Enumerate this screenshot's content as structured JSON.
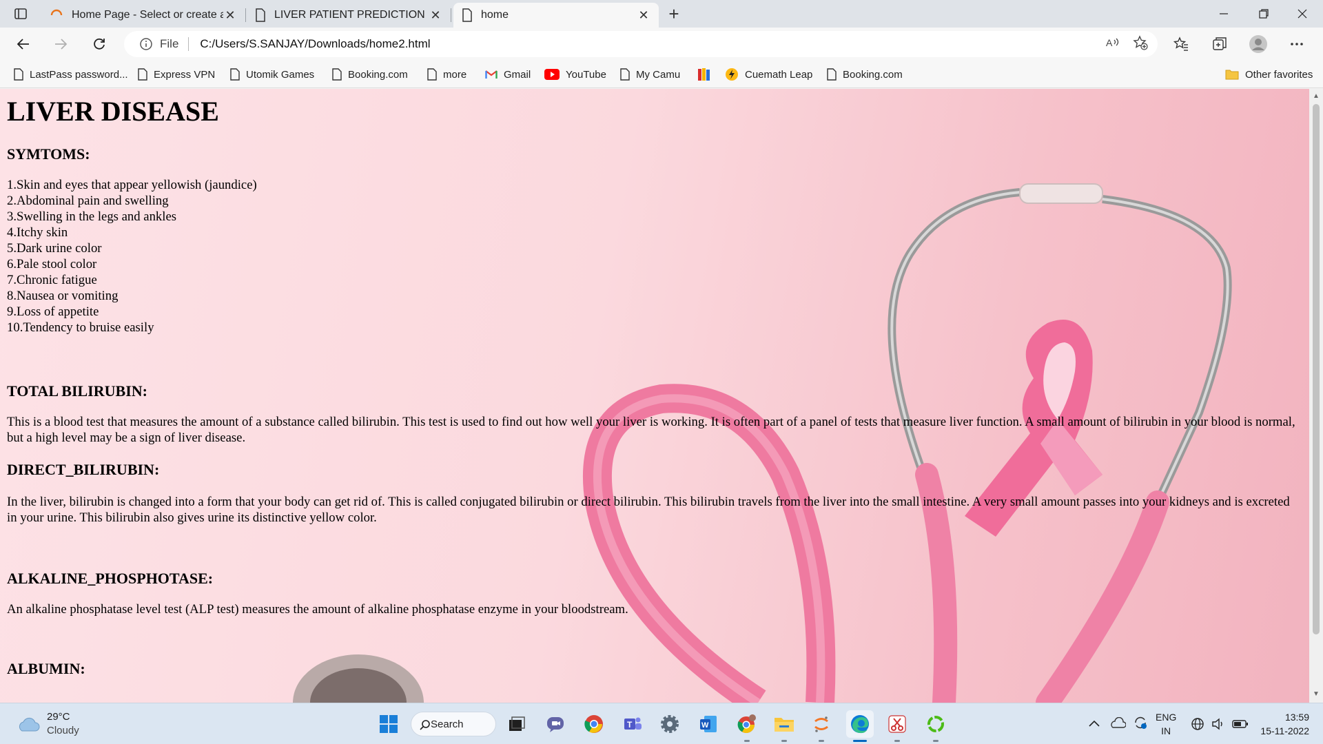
{
  "browser": {
    "tabs": [
      {
        "title": "Home Page - Select or create a n",
        "icon": "loading-spinner-icon",
        "active": false
      },
      {
        "title": "LIVER PATIENT PREDICTION",
        "icon": "page-icon",
        "active": false
      },
      {
        "title": "home",
        "icon": "page-icon",
        "active": true
      }
    ],
    "address": {
      "scheme_label": "File",
      "url": "C:/Users/S.SANJAY/Downloads/home2.html"
    },
    "favorites": [
      {
        "label": "LastPass password...",
        "icon": "page-icon"
      },
      {
        "label": "Express VPN",
        "icon": "page-icon"
      },
      {
        "label": "Utomik Games",
        "icon": "page-icon"
      },
      {
        "label": "Booking.com",
        "icon": "page-icon"
      },
      {
        "label": "more",
        "icon": "page-icon"
      },
      {
        "label": "Gmail",
        "icon": "gmail-icon"
      },
      {
        "label": "YouTube",
        "icon": "youtube-icon"
      },
      {
        "label": "My Camu",
        "icon": "page-icon"
      },
      {
        "label": "",
        "icon": "books-icon"
      },
      {
        "label": "Cuemath Leap",
        "icon": "cuemath-icon"
      },
      {
        "label": "Booking.com",
        "icon": "page-icon"
      }
    ],
    "other_favorites": "Other favorites"
  },
  "page": {
    "title": "LIVER DISEASE",
    "symptoms_heading": "SYMTOMS:",
    "symptoms": [
      "1.Skin and eyes that appear yellowish (jaundice)",
      "2.Abdominal pain and swelling",
      "3.Swelling in the legs and ankles",
      "4.Itchy skin",
      "5.Dark urine color",
      "6.Pale stool color",
      "7.Chronic fatigue",
      "8.Nausea or vomiting",
      "9.Loss of appetite",
      "10.Tendency to bruise easily"
    ],
    "total_bilirubin_heading": "TOTAL BILIRUBIN:",
    "total_bilirubin_text": "This is a blood test that measures the amount of a substance called bilirubin. This test is used to find out how well your liver is working. It is often part of a panel of tests that measure liver function. A small amount of bilirubin in your blood is normal, but a high level may be a sign of liver disease.",
    "direct_bilirubin_heading": "DIRECT_BILIRUBIN:",
    "direct_bilirubin_text": "In the liver, bilirubin is changed into a form that your body can get rid of. This is called conjugated bilirubin or direct bilirubin. This bilirubin travels from the liver into the small intestine. A very small amount passes into your kidneys and is excreted in your urine. This bilirubin also gives urine its distinctive yellow color.",
    "alkaline_heading": "ALKALINE_PHOSPHOTASE:",
    "alkaline_text": "An alkaline phosphatase level test (ALP test) measures the amount of alkaline phosphatase enzyme in your bloodstream.",
    "albumin_heading": "ALBUMIN:"
  },
  "taskbar": {
    "weather_temp": "29°C",
    "weather_desc": "Cloudy",
    "search_label": "Search",
    "lang_primary": "ENG",
    "lang_secondary": "IN",
    "time": "13:59",
    "date": "15-11-2022"
  },
  "colors": {
    "page_bg_left": "#fde2e6",
    "page_bg_right": "#f2b3bf",
    "ribbon_pink": "#f06d9a",
    "taskbar_bg": "#dbe6f2",
    "edge_accent": "#0067c0"
  }
}
